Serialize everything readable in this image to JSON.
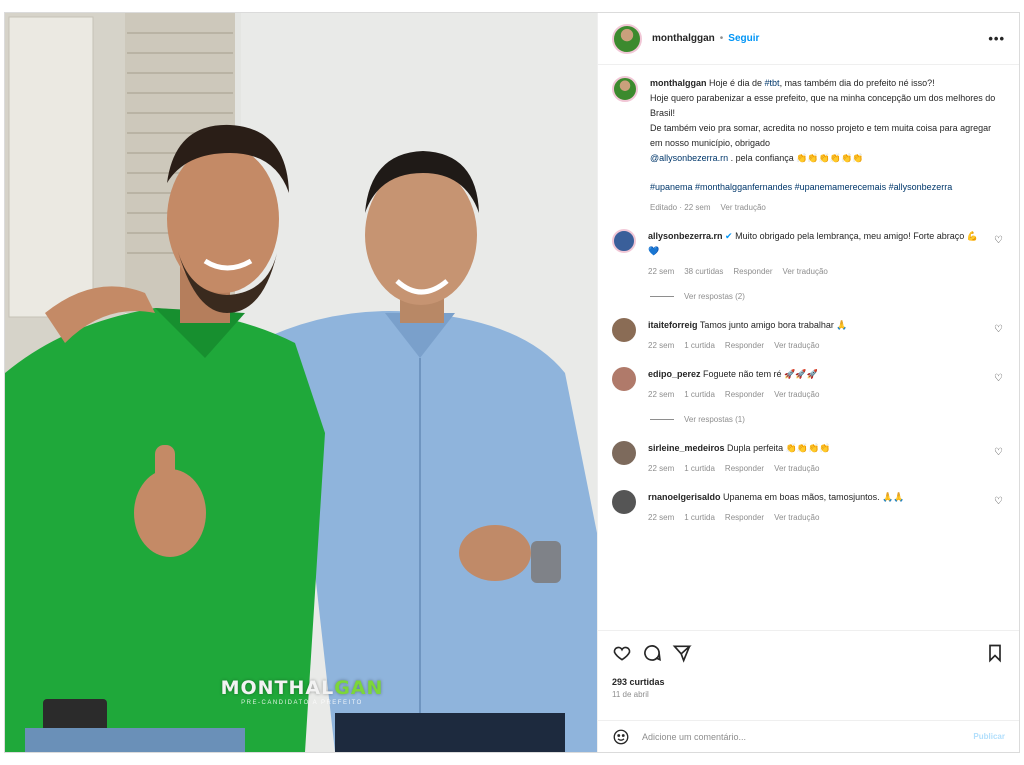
{
  "header": {
    "username": "monthalggan",
    "separator": "•",
    "follow_label": "Seguir",
    "more_label": "•••"
  },
  "caption": {
    "username": "monthalggan",
    "text_1": " Hoje é dia de ",
    "tag_tbt": "#tbt",
    "text_2": ", mas também dia do prefeito né isso?!",
    "line_2": "Hoje quero parabenizar a esse prefeito, que na minha concepção um dos melhores do Brasil!",
    "line_3": "De também veio pra somar, acredita no nosso projeto e tem muita coisa para agregar em nosso município, obrigado",
    "mention": "@allysonbezerra.rn",
    "line_4": " . pela confiança ",
    "hashtags": "#upanema #monthalgganfernandes #upanemamerecemais #allysonbezerra",
    "edited": "Editado · 22 sem",
    "see_translation": "Ver tradução"
  },
  "comments": [
    {
      "username": "allysonbezerra.rn",
      "verified": "✔",
      "text": " Muito obrigado pela lembrança, meu amigo! Forte abraço 💪💙",
      "time": "22 sem",
      "likes": "38 curtidas",
      "reply": "Responder",
      "translate": "Ver tradução",
      "view_replies": "Ver respostas (2)",
      "avatar_color": "#3a5f9a"
    },
    {
      "username": "itaiteforreig",
      "text": " Tamos junto amigo bora trabalhar 🙏",
      "time": "22 sem",
      "likes": "1 curtida",
      "reply": "Responder",
      "translate": "Ver tradução",
      "avatar_color": "#8a6c55"
    },
    {
      "username": "edipo_perez",
      "text": " Foguete não tem ré 🚀🚀🚀",
      "time": "22 sem",
      "likes": "1 curtida",
      "reply": "Responder",
      "translate": "Ver tradução",
      "view_replies": "Ver respostas (1)",
      "avatar_color": "#b07a6a"
    },
    {
      "username": "sirleine_medeiros",
      "text": " Dupla perfeita 👏👏👏👏",
      "time": "22 sem",
      "likes": "1 curtida",
      "reply": "Responder",
      "translate": "Ver tradução",
      "avatar_color": "#7d6a5c"
    },
    {
      "username": "rnanoelgerisaldo",
      "text": " Upanema em boas mãos, tamosjuntos. 🙏🙏",
      "time": "22 sem",
      "likes": "1 curtida",
      "reply": "Responder",
      "translate": "Ver tradução",
      "avatar_color": "#555555"
    }
  ],
  "actions": {
    "likes": "293 curtidas",
    "date": "11 de abril"
  },
  "add_comment": {
    "placeholder": "Adicione um comentário...",
    "publish": "Publicar"
  },
  "watermark": {
    "main_a": "MONTHAL",
    "main_b": "GAN",
    "sub": "PRÉ-CANDIDATO A PREFEITO"
  },
  "colors": {
    "link": "#0095f6",
    "hashtag": "#00376b",
    "muted": "#8e8e8e",
    "green_shirt": "#1fa83a",
    "blue_shirt": "#8fb4dc"
  },
  "icons": [
    "heart-icon",
    "comment-icon",
    "share-icon",
    "save-icon",
    "emoji-icon",
    "more-icon"
  ]
}
